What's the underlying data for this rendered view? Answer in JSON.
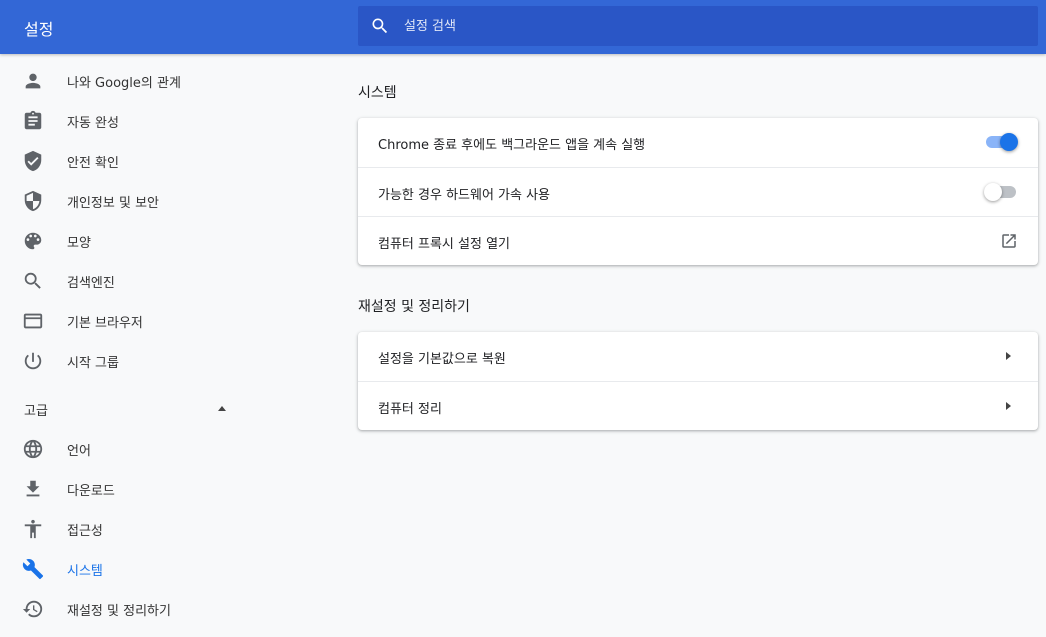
{
  "header": {
    "title": "설정",
    "search_placeholder": "설정 검색",
    "search_value": ""
  },
  "colors": {
    "header_bg": "#3367d6",
    "search_bg": "#2a56c6",
    "accent": "#1a73e8",
    "page_bg": "#f8f9fa"
  },
  "sidebar": {
    "items": [
      {
        "label": "나와 Google의 관계",
        "icon": "person-icon"
      },
      {
        "label": "자동 완성",
        "icon": "clipboard-icon"
      },
      {
        "label": "안전 확인",
        "icon": "shield-check-icon"
      },
      {
        "label": "개인정보 및 보안",
        "icon": "shield-half-icon"
      },
      {
        "label": "모양",
        "icon": "palette-icon"
      },
      {
        "label": "검색엔진",
        "icon": "search-icon"
      },
      {
        "label": "기본 브라우저",
        "icon": "browser-window-icon"
      },
      {
        "label": "시작 그룹",
        "icon": "power-icon"
      }
    ],
    "advanced_label": "고급",
    "advanced_items": [
      {
        "label": "언어",
        "icon": "globe-icon"
      },
      {
        "label": "다운로드",
        "icon": "download-icon"
      },
      {
        "label": "접근성",
        "icon": "accessibility-icon"
      },
      {
        "label": "시스템",
        "icon": "wrench-icon",
        "active": true
      },
      {
        "label": "재설정 및 정리하기",
        "icon": "restore-icon"
      }
    ]
  },
  "main": {
    "system": {
      "title": "시스템",
      "rows": [
        {
          "label": "Chrome 종료 후에도 백그라운드 앱을 계속 실행",
          "control": "toggle",
          "on": true
        },
        {
          "label": "가능한 경우 하드웨어 가속 사용",
          "control": "toggle",
          "on": false
        },
        {
          "label": "컴퓨터 프록시 설정 열기",
          "control": "external-link-icon"
        }
      ]
    },
    "reset": {
      "title": "재설정 및 정리하기",
      "rows": [
        {
          "label": "설정을 기본값으로 복원",
          "control": "chevron-right-icon"
        },
        {
          "label": "컴퓨터 정리",
          "control": "chevron-right-icon"
        }
      ]
    }
  }
}
